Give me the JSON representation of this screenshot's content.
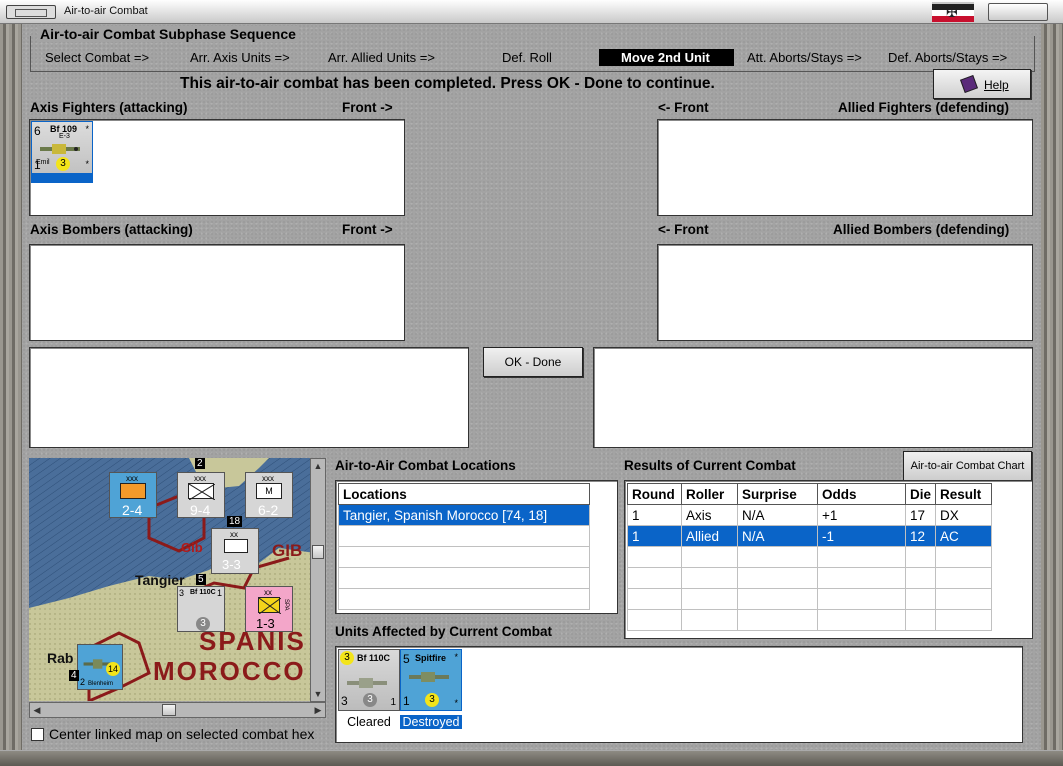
{
  "window": {
    "title": "Air-to-air Combat"
  },
  "subphase": {
    "title": "Air-to-air Combat Subphase Sequence",
    "steps": [
      "Select Combat =>",
      "Arr. Axis Units =>",
      "Arr. Allied Units =>",
      "Def. Roll",
      "Move 2nd Unit",
      "Att. Aborts/Stays =>",
      "Def. Aborts/Stays =>"
    ],
    "active_step": "Move 2nd Unit"
  },
  "status_message": "This air-to-air combat has been completed.  Press OK - Done to continue.",
  "help_button": "Help",
  "axis_fighters": {
    "label": "Axis Fighters (attacking)",
    "front": "Front ->",
    "counter": {
      "top_left": "6",
      "name": "Bf 109",
      "variant": "E-3",
      "tag": "Emil",
      "bottom_left": "1",
      "dot": "3",
      "corner": "*"
    }
  },
  "allied_fighters": {
    "label": "Allied Fighters (defending)",
    "front": "<- Front"
  },
  "axis_bombers": {
    "label": "Axis Bombers (attacking)",
    "front": "Front ->"
  },
  "allied_bombers": {
    "label": "Allied Bombers (defending)",
    "front": "<- Front"
  },
  "ok_button": "OK - Done",
  "map": {
    "labels": {
      "gib_small": "Gib",
      "gib": "GIB",
      "tangier": "Tangier",
      "spanish": "SPANIS",
      "morocco": "MOROCCO",
      "rab": "Rab"
    },
    "counters": [
      {
        "top": "xxx",
        "value": "2-4"
      },
      {
        "top": "xxx",
        "value": "9-4",
        "mark": "2"
      },
      {
        "top": "xxx",
        "value": "6-2",
        "letter": "M"
      },
      {
        "top": "xx",
        "value": "3-3",
        "mark": "18"
      },
      {
        "top": "xx",
        "value": "1-3",
        "side": "SPA"
      },
      {
        "name": "Bf 110C",
        "value": "3",
        "left": "3",
        "right": "1"
      },
      {
        "name": "Blenheim",
        "value": "14",
        "bottom": "2"
      }
    ],
    "mark_5": "5",
    "mark_4": "4"
  },
  "center_map_checkbox": {
    "label": "Center linked map on selected combat hex",
    "checked": false
  },
  "locations": {
    "title": "Air-to-Air Combat Locations",
    "header": "Locations",
    "rows": [
      "Tangier, Spanish Morocco [74, 18]",
      "",
      "",
      "",
      ""
    ]
  },
  "results": {
    "title": "Results of Current Combat",
    "chart_button": "Air-to-air Combat Chart",
    "columns": [
      "Round",
      "Roller",
      "Surprise",
      "Odds",
      "Die",
      "Result"
    ],
    "rows": [
      [
        "1",
        "Axis",
        "N/A",
        "+1",
        "17",
        "DX"
      ],
      [
        "1",
        "Allied",
        "N/A",
        "-1",
        "12",
        "AC"
      ],
      [
        "",
        "",
        "",
        "",
        "",
        ""
      ],
      [
        "",
        "",
        "",
        "",
        "",
        ""
      ],
      [
        "",
        "",
        "",
        "",
        "",
        ""
      ],
      [
        "",
        "",
        "",
        "",
        "",
        ""
      ]
    ],
    "selected_row": 1
  },
  "affected": {
    "title": "Units Affected by Current Combat",
    "units": [
      {
        "name": "Bf 110C",
        "top_left": "3",
        "top_right": "1",
        "bottom_left": "3",
        "dot": "3",
        "bottom_right": "1",
        "status": "Cleared"
      },
      {
        "name": "Spitfire",
        "top_left": "5",
        "bottom_left": "1",
        "dot": "3",
        "corner": "*",
        "status": "Destroyed"
      }
    ]
  },
  "colors": {
    "selection": "#0a64c8",
    "panel_bg": "#a3a3a3",
    "axis_counter": "#c4c4c4",
    "allied_counter": "#4fa3d6",
    "map_land": "#c8c79a",
    "map_sea": "#4a6e9a",
    "map_border": "#8b1a1a"
  }
}
